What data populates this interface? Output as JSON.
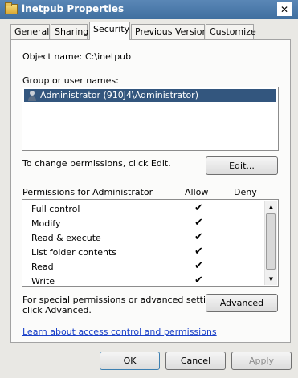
{
  "window": {
    "title": "inetpub Properties",
    "close_glyph": "✕"
  },
  "tabs": [
    {
      "label": "General"
    },
    {
      "label": "Sharing"
    },
    {
      "label": "Security"
    },
    {
      "label": "Previous Versions"
    },
    {
      "label": "Customize"
    }
  ],
  "security": {
    "object_name_label": "Object name:",
    "object_name_value": "C:\\inetpub",
    "groups_label": "Group or user names:",
    "users": [
      {
        "name": "Administrator (910J4\\Administrator)",
        "icon": "user-icon",
        "selected": true
      }
    ],
    "change_text": "To change permissions, click Edit.",
    "edit_label": "Edit...",
    "permissions_for": "Permissions for Administrator",
    "allow_header": "Allow",
    "deny_header": "Deny",
    "permissions": [
      {
        "name": "Full control",
        "allow": "✔",
        "deny": ""
      },
      {
        "name": "Modify",
        "allow": "✔",
        "deny": ""
      },
      {
        "name": "Read & execute",
        "allow": "✔",
        "deny": ""
      },
      {
        "name": "List folder contents",
        "allow": "✔",
        "deny": ""
      },
      {
        "name": "Read",
        "allow": "✔",
        "deny": ""
      },
      {
        "name": "Write",
        "allow": "✔",
        "deny": ""
      }
    ],
    "special_text_1": "For special permissions or advanced settings,",
    "special_text_2": "click Advanced.",
    "advanced_label": "Advanced",
    "learn_link": "Learn about access control and permissions"
  },
  "footer": {
    "ok_label": "OK",
    "cancel_label": "Cancel",
    "apply_label": "Apply"
  },
  "colors": {
    "titlebar": "#4a7aab",
    "selection": "#33567e",
    "link": "#1a40c8"
  }
}
